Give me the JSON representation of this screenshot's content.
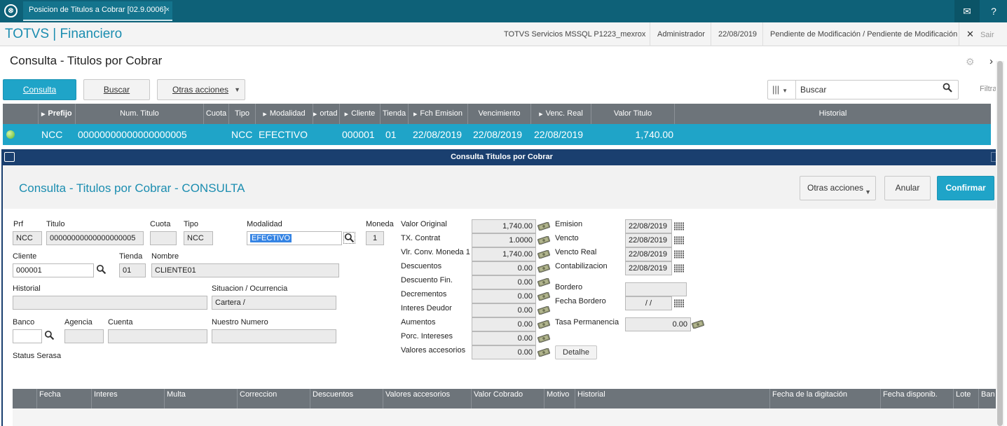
{
  "topbar": {
    "logo_glyph": "⊗",
    "tab_label": "Posicion de Titulos a Cobrar [02.9.0006]",
    "tab_close": "×",
    "mail_icon": "✉",
    "help_icon": "?"
  },
  "header": {
    "brand": "TOTVS | Financiero",
    "env": "TOTVS Servicios MSSQL P1223_mexrox",
    "user": "Administrador",
    "date": "22/08/2019",
    "status": "Pendiente de Modificación / Pendiente de Modificación",
    "exit_icon": "✕",
    "exit_label": "Sair"
  },
  "page": {
    "title": "Consulta - Titulos por Cobrar",
    "gear_icon": "⚙",
    "close_icon": "›"
  },
  "toolbar": {
    "consulta": "Consulta",
    "buscar": "Buscar",
    "otras": "Otras acciones",
    "search_value": "Buscar",
    "filtrar": "Filtrar"
  },
  "grid": {
    "headers": [
      "Prefijo",
      "Num. Titulo",
      "Cuota",
      "Tipo",
      "Modalidad",
      "ortad",
      "Cliente",
      "Tienda",
      "Fch Emision",
      "Vencimiento",
      "Venc. Real",
      "Valor Titulo",
      "Historial"
    ],
    "row": {
      "prefijo": "NCC",
      "num_titulo": "00000000000000000005",
      "tipo": "NCC",
      "modalidad": "EFECTIVO",
      "cliente": "000001",
      "tienda": "01",
      "emision": "22/08/2019",
      "vencimiento": "22/08/2019",
      "venc_real": "22/08/2019",
      "valor": "1,740.00"
    }
  },
  "dialog": {
    "title": "Consulta Titulos por Cobrar",
    "heading": "Consulta - Titulos por Cobrar - CONSULTA",
    "otras": "Otras acciones",
    "anular": "Anular",
    "confirmar": "Confirmar"
  },
  "form": {
    "prf_label": "Prf",
    "prf": "NCC",
    "titulo_label": "Titulo",
    "titulo": "00000000000000000005",
    "cuota_label": "Cuota",
    "cuota": "",
    "tipo_label": "Tipo",
    "tipo": "NCC",
    "modalidad_label": "Modalidad",
    "modalidad": "EFECTIVO",
    "moneda_label": "Moneda",
    "moneda": "1",
    "cliente_label": "Cliente",
    "cliente": "000001",
    "tienda_label": "Tienda",
    "tienda": "01",
    "nombre_label": "Nombre",
    "nombre": "CLIENTE01",
    "historial_label": "Historial",
    "historial": "",
    "situacion_label": "Situacion / Ocurrencia",
    "situacion": "Cartera /",
    "banco_label": "Banco",
    "banco": "",
    "agencia_label": "Agencia",
    "agencia": "",
    "cuenta_label": "Cuenta",
    "cuenta": "",
    "nuestro_label": "Nuestro Numero",
    "nuestro": "",
    "serasa_label": "Status Serasa"
  },
  "values": [
    {
      "label": "Valor Original",
      "value": "1,740.00"
    },
    {
      "label": "TX. Contrat",
      "value": "1.0000"
    },
    {
      "label": "Vlr. Conv. Moneda 1",
      "value": "1,740.00"
    },
    {
      "label": "Descuentos",
      "value": "0.00"
    },
    {
      "label": "Descuento Fin.",
      "value": "0.00"
    },
    {
      "label": "Decrementos",
      "value": "0.00"
    },
    {
      "label": "Interes Deudor",
      "value": "0.00"
    },
    {
      "label": "Aumentos",
      "value": "0.00"
    },
    {
      "label": "Porc. Intereses",
      "value": "0.00"
    },
    {
      "label": "Valores accesorios",
      "value": "0.00"
    }
  ],
  "dates": {
    "emision_label": "Emision",
    "emision": "22/08/2019",
    "vencto_label": "Vencto",
    "vencto": "22/08/2019",
    "vencto_real_label": "Vencto Real",
    "vencto_real": "22/08/2019",
    "contab_label": "Contabilizacion",
    "contab": "22/08/2019",
    "bordero_label": "Bordero",
    "bordero": "",
    "fecha_bordero_label": "Fecha Bordero",
    "fecha_bordero": "/ /",
    "tasa_label": "Tasa Permanencia",
    "tasa": "0.00",
    "detalhe": "Detalhe"
  },
  "bottom_grid": {
    "headers": [
      "Fecha",
      "Interes",
      "Multa",
      "Correccion",
      "Descuentos",
      "Valores accesorios",
      "Valor Cobrado",
      "Motivo",
      "Historial",
      "Fecha de la digitación",
      "Fecha disponib.",
      "Lote",
      "Ban"
    ]
  },
  "colors": {
    "accent": "#1fa4c8",
    "topbar": "#0e6178",
    "dialog_bar": "#1a3f6f",
    "grid_header": "#6d747a"
  }
}
